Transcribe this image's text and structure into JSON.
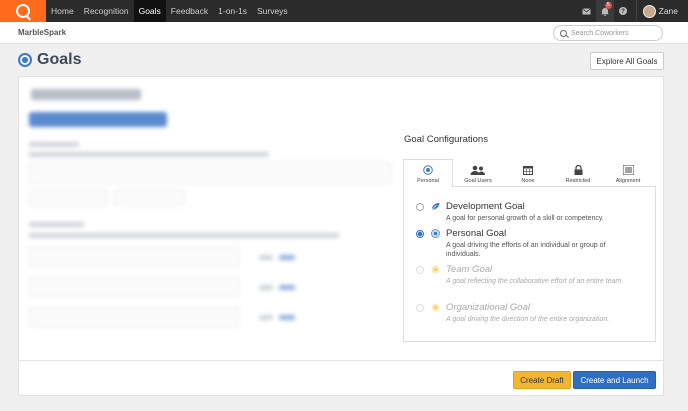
{
  "nav": {
    "items": [
      {
        "label": "Home",
        "active": false
      },
      {
        "label": "Recognition",
        "active": false
      },
      {
        "label": "Goals",
        "active": true
      },
      {
        "label": "Feedback",
        "active": false
      },
      {
        "label": "1-on-1s",
        "active": false
      },
      {
        "label": "Surveys",
        "active": false
      }
    ],
    "notification_count": "5",
    "user_name": "Zane"
  },
  "subheader": {
    "brand": "MarbleSpark",
    "search_placeholder": "Search Coworkers"
  },
  "page": {
    "title": "Goals",
    "explore_button": "Explore All Goals"
  },
  "config": {
    "title": "Goal Configurations",
    "tabs": [
      {
        "label": "Personal",
        "icon": "target-icon",
        "active": true
      },
      {
        "label": "Goal Users",
        "icon": "users-icon",
        "active": false
      },
      {
        "label": "None",
        "icon": "calendar-icon",
        "active": false
      },
      {
        "label": "Restricted",
        "icon": "lock-icon",
        "active": false
      },
      {
        "label": "Alignment",
        "icon": "list-icon",
        "active": false
      }
    ],
    "options": [
      {
        "name": "Development Goal",
        "desc": "A goal for personal growth of a skill or competency.",
        "icon": "leaf-icon",
        "checked": false,
        "disabled": false
      },
      {
        "name": "Personal Goal",
        "desc": "A goal driving the efforts of an individual or group of individuals.",
        "icon": "target-icon",
        "checked": true,
        "disabled": false
      },
      {
        "name": "Team Goal",
        "desc": "A goal reflecting the collaborative effort of an entire team.",
        "icon": "target-icon",
        "checked": false,
        "disabled": true
      },
      {
        "name": "Organizational Goal",
        "desc": "A goal driving the direction of the entire organization.",
        "icon": "target-icon",
        "checked": false,
        "disabled": true
      }
    ]
  },
  "actions": {
    "draft": "Create Draft",
    "launch": "Create and Launch"
  },
  "colors": {
    "brand_orange": "#ff6b1a",
    "primary_blue": "#2f6fc1",
    "draft_yellow": "#f2b632"
  }
}
